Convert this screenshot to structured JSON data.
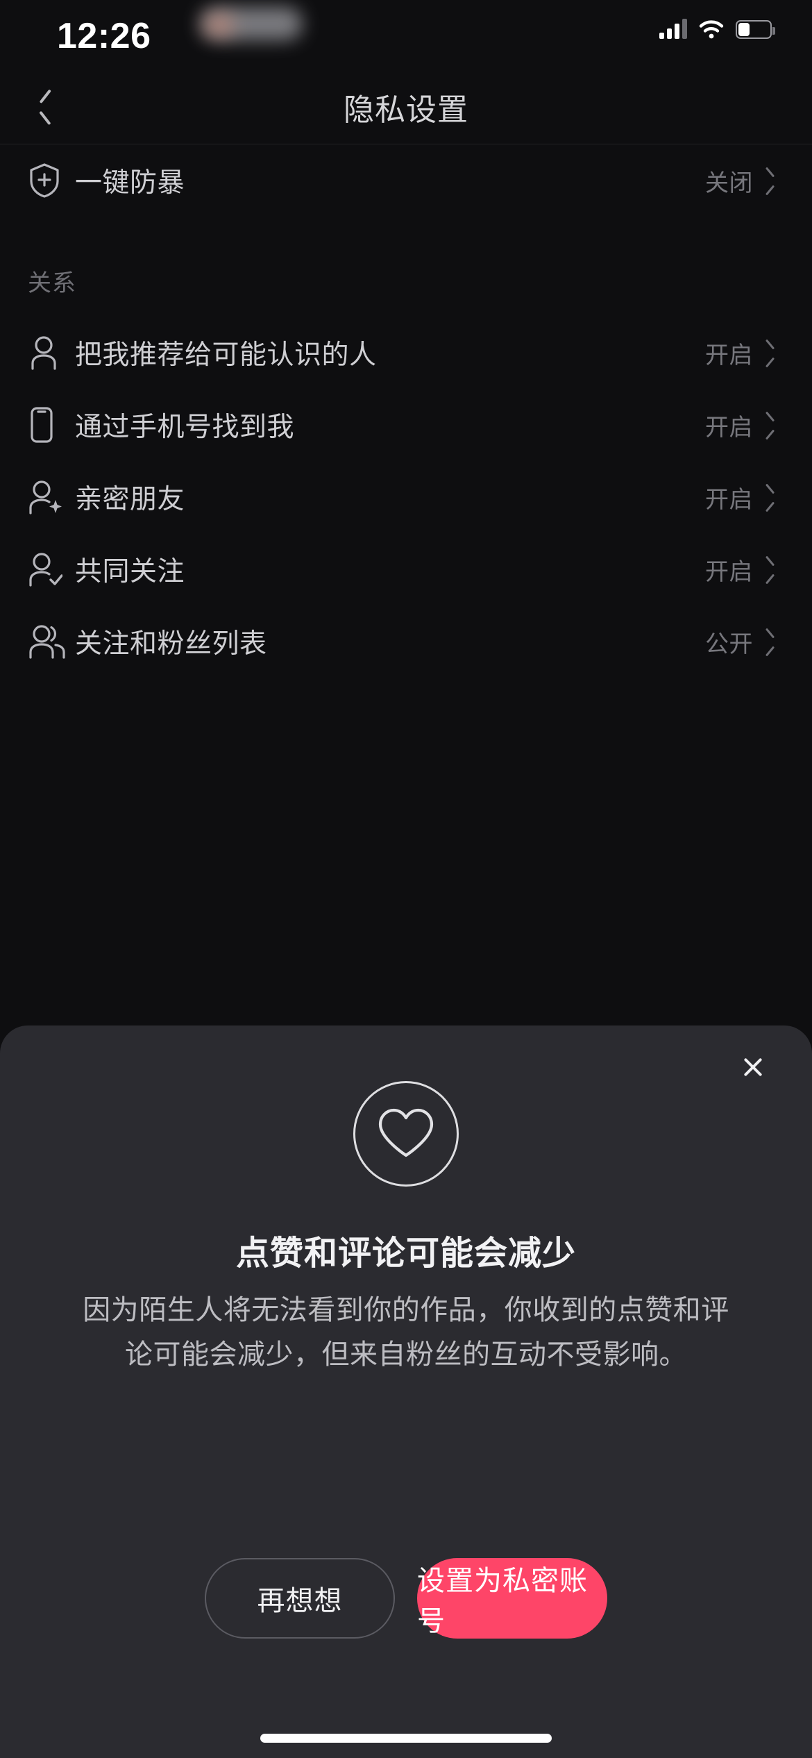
{
  "status_bar": {
    "time": "12:26",
    "signal_icon": "cellular-signal-icon",
    "wifi_icon": "wifi-icon",
    "battery_icon": "battery-icon"
  },
  "header": {
    "title": "隐私设置",
    "back_icon": "chevron-left-icon"
  },
  "list": {
    "top_rows": [
      {
        "icon": "shield-plus-icon",
        "label": "一键防暴",
        "value": "关闭"
      }
    ],
    "sections": [
      {
        "title": "关系",
        "rows": [
          {
            "icon": "person-icon",
            "label": "把我推荐给可能认识的人",
            "value": "开启"
          },
          {
            "icon": "phone-icon",
            "label": "通过手机号找到我",
            "value": "开启"
          },
          {
            "icon": "person-star-icon",
            "label": "亲密朋友",
            "value": "开启"
          },
          {
            "icon": "person-check-icon",
            "label": "共同关注",
            "value": "开启"
          },
          {
            "icon": "people-group-icon",
            "label": "关注和粉丝列表",
            "value": "公开"
          }
        ]
      }
    ]
  },
  "modal": {
    "close_icon": "close-icon",
    "hero_icon": "heart-outline-icon",
    "title": "点赞和评论可能会减少",
    "body": "因为陌生人将无法看到你的作品，你收到的点赞和评论可能会减少，但来自粉丝的互动不受影响。",
    "secondary_button": "再想想",
    "primary_button": "设置为私密账号",
    "primary_color": "#fe4568"
  }
}
